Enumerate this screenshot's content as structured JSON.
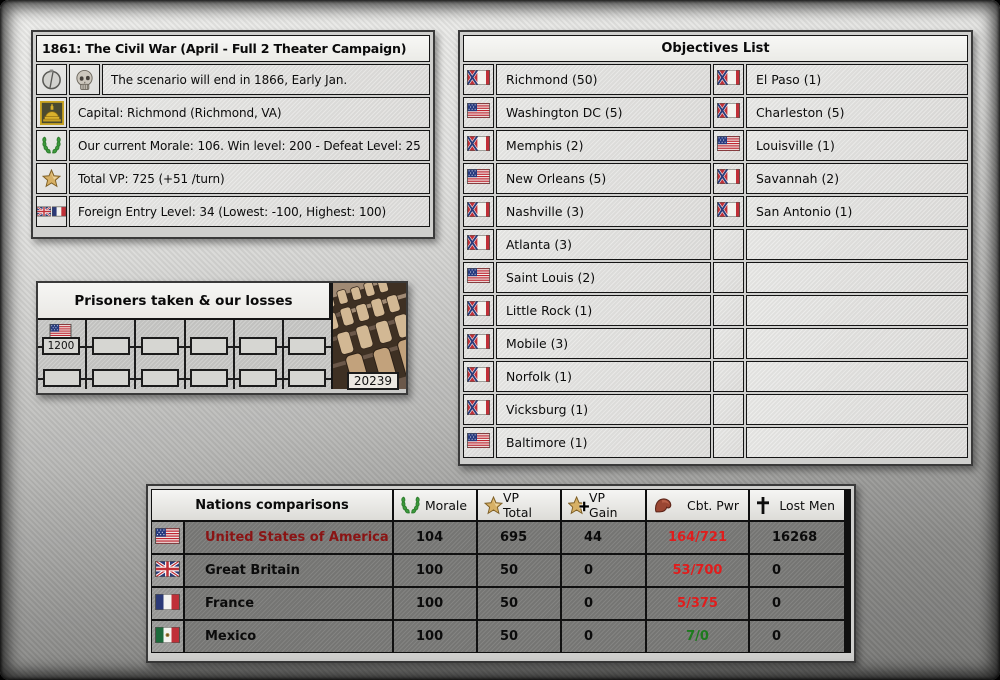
{
  "colors": {
    "accent_red": "#e01d1d",
    "accent_green": "#1d7a1d",
    "usa_name_red": "#8a1414",
    "text": "#0b0b0b"
  },
  "scenario_panel": {
    "title": "1861: The Civil War (April - Full 2 Theater Campaign)",
    "rows": [
      {
        "icon_cells": [
          [
            "clock-icon"
          ],
          [
            "skull-icon"
          ]
        ],
        "text": "The scenario will end in 1866, Early Jan."
      },
      {
        "icon_cells": [
          [
            "capitol-icon"
          ]
        ],
        "text": "Capital: Richmond (Richmond, VA)"
      },
      {
        "icon_cells": [
          [
            "laurel-icon"
          ]
        ],
        "text": "Our current Morale: 106. Win level: 200 - Defeat Level: 25"
      },
      {
        "icon_cells": [
          [
            "star-icon"
          ]
        ],
        "text": "Total VP: 725 (+51 /turn)"
      },
      {
        "icon_cells": [
          [
            "uk-flag",
            "france-flag"
          ]
        ],
        "text": "Foreign Entry Level: 34  (Lowest: -100, Highest: 100)"
      }
    ]
  },
  "prisoners_panel": {
    "title": "Prisoners taken & our losses",
    "flag": "usa-flag",
    "prisoners_value": "1200",
    "losses_value": "20239",
    "columns": 6,
    "photo": "cemetery-gravestones-photo"
  },
  "objectives_panel": {
    "title": "Objectives List",
    "left": [
      {
        "flag": "csa-flag",
        "label": "Richmond (50)"
      },
      {
        "flag": "usa-flag",
        "label": "Washington DC (5)"
      },
      {
        "flag": "csa-flag",
        "label": "Memphis (2)"
      },
      {
        "flag": "usa-flag",
        "label": "New Orleans (5)"
      },
      {
        "flag": "csa-flag",
        "label": "Nashville (3)"
      },
      {
        "flag": "csa-flag",
        "label": "Atlanta (3)"
      },
      {
        "flag": "usa-flag",
        "label": "Saint Louis (2)"
      },
      {
        "flag": "csa-flag",
        "label": "Little Rock (1)"
      },
      {
        "flag": "csa-flag",
        "label": "Mobile (3)"
      },
      {
        "flag": "csa-flag",
        "label": "Norfolk (1)"
      },
      {
        "flag": "csa-flag",
        "label": "Vicksburg (1)"
      },
      {
        "flag": "usa-flag",
        "label": "Baltimore (1)"
      }
    ],
    "right": [
      {
        "flag": "csa-flag",
        "label": "El Paso (1)"
      },
      {
        "flag": "csa-flag",
        "label": "Charleston (5)"
      },
      {
        "flag": "usa-flag",
        "label": "Louisville (1)"
      },
      {
        "flag": "csa-flag",
        "label": "Savannah (2)"
      },
      {
        "flag": "csa-flag",
        "label": "San Antonio (1)"
      },
      {
        "flag": null,
        "label": ""
      },
      {
        "flag": null,
        "label": ""
      },
      {
        "flag": null,
        "label": ""
      },
      {
        "flag": null,
        "label": ""
      },
      {
        "flag": null,
        "label": ""
      },
      {
        "flag": null,
        "label": ""
      },
      {
        "flag": null,
        "label": ""
      }
    ]
  },
  "nations_panel": {
    "title": "Nations comparisons",
    "columns": [
      {
        "icon": "laurel-icon",
        "label": "Morale"
      },
      {
        "icon": "star-icon",
        "label": "VP Total"
      },
      {
        "icon": "star-plus-icon",
        "label": "VP Gain"
      },
      {
        "icon": "bicep-icon",
        "label": "Cbt. Pwr"
      },
      {
        "icon": "cross-icon",
        "label": "Lost Men"
      }
    ],
    "rows": [
      {
        "flag": "usa-flag",
        "name": "United States of America",
        "name_color": "#8a1414",
        "morale": "104",
        "vp_total": "695",
        "vp_gain": "44",
        "cbt_pwr": "164/721",
        "cbt_color": "#e01d1d",
        "lost_men": "16268"
      },
      {
        "flag": "uk-flag",
        "name": "Great Britain",
        "name_color": "#0b0b0b",
        "morale": "100",
        "vp_total": "50",
        "vp_gain": "0",
        "cbt_pwr": "53/700",
        "cbt_color": "#e01d1d",
        "lost_men": "0"
      },
      {
        "flag": "france-flag",
        "name": "France",
        "name_color": "#0b0b0b",
        "morale": "100",
        "vp_total": "50",
        "vp_gain": "0",
        "cbt_pwr": "5/375",
        "cbt_color": "#e01d1d",
        "lost_men": "0"
      },
      {
        "flag": "mexico-flag",
        "name": "Mexico",
        "name_color": "#0b0b0b",
        "morale": "100",
        "vp_total": "50",
        "vp_gain": "0",
        "cbt_pwr": "7/0",
        "cbt_color": "#1d7a1d",
        "lost_men": "0"
      }
    ]
  }
}
